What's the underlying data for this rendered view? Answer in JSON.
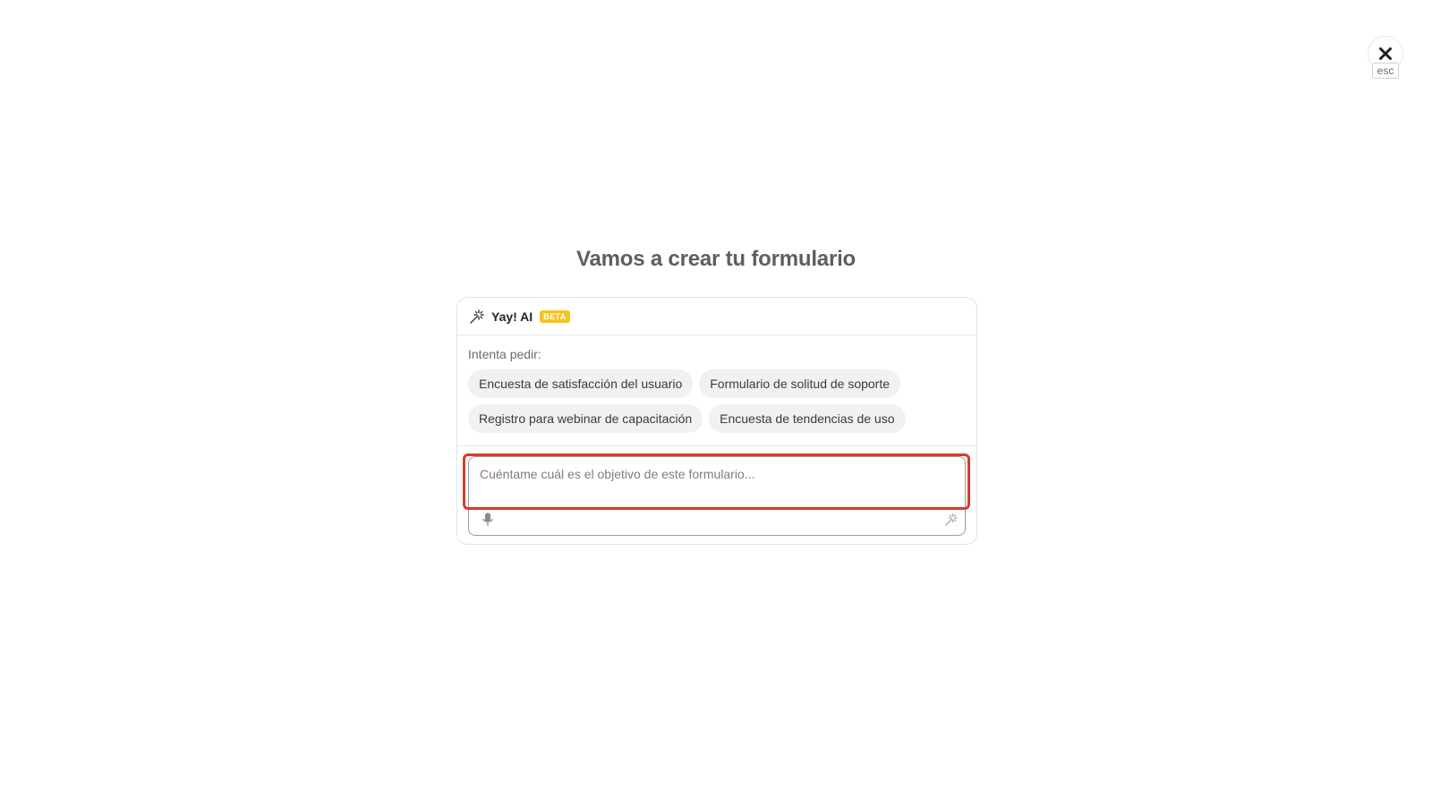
{
  "close": {
    "icon": "close-icon",
    "esc_label": "esc"
  },
  "title": "Vamos a crear tu formulario",
  "assistant": {
    "icon": "magic-wand-icon",
    "name": "Yay! AI",
    "badge": "BETA",
    "badge_color": "#f4c420"
  },
  "suggestions": {
    "label": "Intenta pedir:",
    "chips": [
      "Encuesta de satisfacción del usuario",
      "Formulario de solitud de soporte",
      "Registro para webinar de capacitación",
      "Encuesta de tendencias de uso"
    ]
  },
  "prompt": {
    "placeholder": "Cuéntame cuál es el objetivo de este formulario...",
    "value": "",
    "mic_icon": "microphone-icon",
    "generate_icon": "magic-wand-icon"
  },
  "highlight_color": "#d93a2b"
}
